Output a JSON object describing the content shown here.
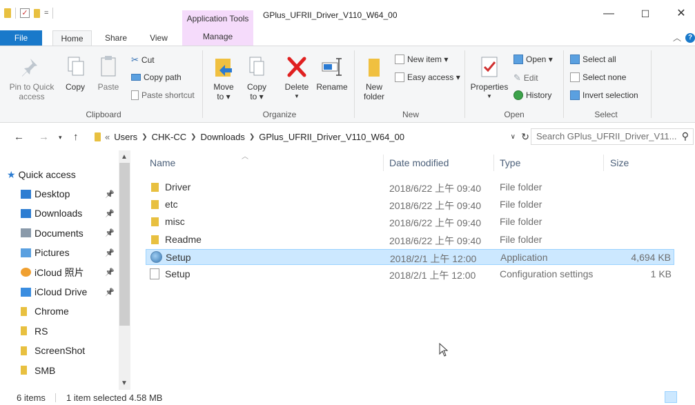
{
  "titlebar": {
    "context_tab_header": "Application Tools",
    "title": "GPlus_UFRII_Driver_V110_W64_00",
    "qat_dropdown": "="
  },
  "window_controls": {
    "minimize": "—",
    "maximize": "☐",
    "close": "✕"
  },
  "tabs": [
    {
      "label": "File"
    },
    {
      "label": "Home"
    },
    {
      "label": "Share"
    },
    {
      "label": "View"
    },
    {
      "label": "Manage"
    }
  ],
  "help_label": "?",
  "ribbon": {
    "clipboard": {
      "label": "Clipboard",
      "pin": "Pin to Quick access",
      "copy": "Copy",
      "paste": "Paste",
      "cut": "Cut",
      "copy_path": "Copy path",
      "paste_shortcut": "Paste shortcut"
    },
    "organize": {
      "label": "Organize",
      "move_to": "Move to ▾",
      "copy_to": "Copy to ▾",
      "delete": "Delete",
      "rename": "Rename"
    },
    "new": {
      "label": "New",
      "new_folder": "New folder",
      "new_item": "New item ▾",
      "easy_access": "Easy access ▾"
    },
    "open": {
      "label": "Open",
      "properties": "Properties",
      "open": "Open ▾",
      "edit": "Edit",
      "history": "History"
    },
    "select": {
      "label": "Select",
      "select_all": "Select all",
      "select_none": "Select none",
      "invert": "Invert selection"
    }
  },
  "address": {
    "overflow": "«",
    "crumbs": [
      "Users",
      "CHK-CC",
      "Downloads",
      "GPlus_UFRII_Driver_V110_W64_00"
    ],
    "search_placeholder": "Search GPlus_UFRII_Driver_V11..."
  },
  "nav": {
    "quick_access": "Quick access",
    "items": [
      {
        "label": "Desktop",
        "icon": "desktop-icon",
        "color": "#2d7dd2",
        "pinned": true
      },
      {
        "label": "Downloads",
        "icon": "downloads-icon",
        "color": "#2d7dd2",
        "pinned": true
      },
      {
        "label": "Documents",
        "icon": "documents-icon",
        "color": "#8a9aaa",
        "pinned": true
      },
      {
        "label": "Pictures",
        "icon": "pictures-icon",
        "color": "#5aa0e0",
        "pinned": true
      },
      {
        "label": "iCloud 照片",
        "icon": "icloud-photos-icon",
        "color": "#f0a030",
        "pinned": true
      },
      {
        "label": "iCloud Drive",
        "icon": "icloud-drive-icon",
        "color": "#3a8de0",
        "pinned": true
      },
      {
        "label": "Chrome",
        "icon": "folder-icon",
        "color": "#e8c040",
        "pinned": false
      },
      {
        "label": "RS",
        "icon": "folder-icon",
        "color": "#e8c040",
        "pinned": false
      },
      {
        "label": "ScreenShot",
        "icon": "folder-icon",
        "color": "#e8c040",
        "pinned": false
      },
      {
        "label": "SMB",
        "icon": "folder-icon",
        "color": "#e8c040",
        "pinned": false
      }
    ]
  },
  "columns": {
    "name": "Name",
    "date": "Date modified",
    "type": "Type",
    "size": "Size"
  },
  "files": [
    {
      "name": "Driver",
      "date": "2018/6/22 上午 09:40",
      "type": "File folder",
      "size": "",
      "icon": "folder-icon",
      "selected": false
    },
    {
      "name": "etc",
      "date": "2018/6/22 上午 09:40",
      "type": "File folder",
      "size": "",
      "icon": "folder-icon",
      "selected": false
    },
    {
      "name": "misc",
      "date": "2018/6/22 上午 09:40",
      "type": "File folder",
      "size": "",
      "icon": "folder-icon",
      "selected": false
    },
    {
      "name": "Readme",
      "date": "2018/6/22 上午 09:40",
      "type": "File folder",
      "size": "",
      "icon": "folder-icon",
      "selected": false
    },
    {
      "name": "Setup",
      "date": "2018/2/1 上午 12:00",
      "type": "Application",
      "size": "4,694 KB",
      "icon": "setup-app-icon",
      "selected": true
    },
    {
      "name": "Setup",
      "date": "2018/2/1 上午 12:00",
      "type": "Configuration settings",
      "size": "1 KB",
      "icon": "config-file-icon",
      "selected": false
    }
  ],
  "status": {
    "items": "6 items",
    "selected": "1 item selected  4.58 MB"
  }
}
